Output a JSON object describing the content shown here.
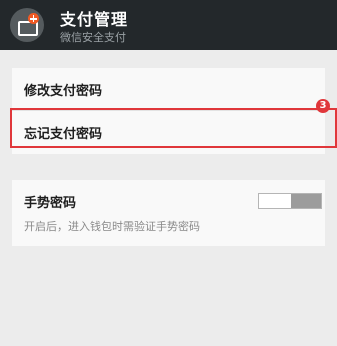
{
  "header": {
    "icon": "wallet-card-add-icon",
    "title": "支付管理",
    "subtitle": "微信安全支付"
  },
  "settings": {
    "modify_password": "修改支付密码",
    "forgot_password": "忘记支付密码",
    "step_badge": "3",
    "gesture_label": "手势密码",
    "gesture_desc": "开启后，进入钱包时需验证手势密码",
    "gesture_toggle": "off"
  },
  "colors": {
    "header_bg": "#23282b",
    "highlight": "#e0373b",
    "badge_icon": "#f15a24"
  }
}
